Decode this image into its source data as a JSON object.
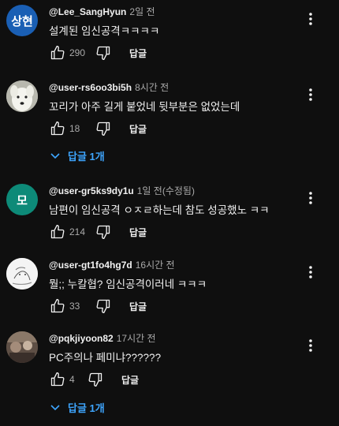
{
  "comments": [
    {
      "avatar_text": "상현",
      "avatar_color": "#1a5fb4",
      "handle": "@Lee_SangHyun",
      "time": "2일 전",
      "text": "설계된 임신공격ㅋㅋㅋㅋ",
      "likes": "290",
      "reply_label": "답글"
    },
    {
      "avatar_icon": "white-dog-avatar",
      "handle": "@user-rs6oo3bi5h",
      "time": "8시간 전",
      "text": "꼬리가 아주 길게 붙었네 뒷부분은 없었는데",
      "likes": "18",
      "reply_label": "답글",
      "replies_label": "답글 1개"
    },
    {
      "avatar_text": "모",
      "avatar_color": "#0d8a78",
      "handle": "@user-gr5ks9dy1u",
      "time": "1일 전(수정됨)",
      "text": "남편이 임신공격 ㅇㅈㄹ하는데 참도 성공했노 ㅋㅋ",
      "likes": "214",
      "reply_label": "답글"
    },
    {
      "avatar_icon": "sketch-avatar",
      "handle": "@user-gt1fo4hg7d",
      "time": "16시간 전",
      "text": "뭘;; 누칼협? 임신공격이러네 ㅋㅋㅋ",
      "likes": "33",
      "reply_label": "답글"
    },
    {
      "avatar_icon": "photo-avatar",
      "handle": "@pqkjiyoon82",
      "time": "17시간 전",
      "text": "PC주의나 페미냐??????",
      "likes": "4",
      "reply_label": "답글",
      "replies_label": "답글 1개"
    }
  ],
  "colors": {
    "background": "#0f0f0f",
    "link": "#3ea6ff",
    "muted": "#aaaaaa"
  }
}
